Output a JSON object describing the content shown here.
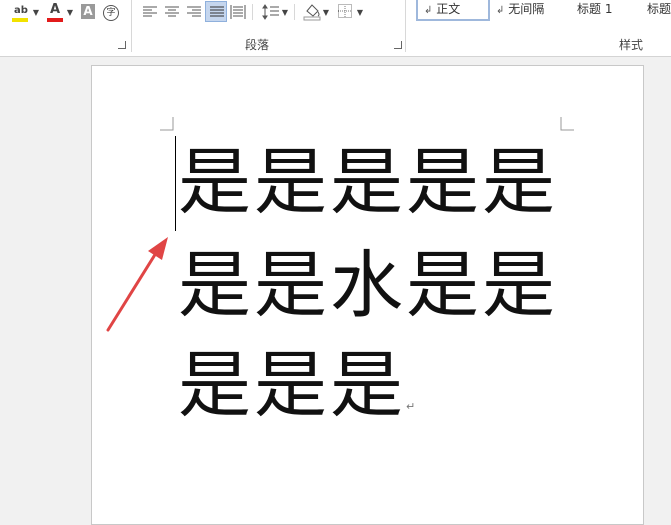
{
  "ribbon": {
    "font_group": {
      "highlight_icon": "highlight-color-icon",
      "highlight_color": "#f2e200",
      "font_color_icon": "font-color-icon",
      "font_color": "#e21b1b",
      "char_shading_label": "A",
      "enclosed_char_label": "字"
    },
    "paragraph_group": {
      "label": "段落"
    },
    "styles_group": {
      "label": "样式",
      "items": [
        {
          "label": "正文",
          "marker": "↲"
        },
        {
          "label": "无间隔",
          "marker": "↲"
        },
        {
          "label": "标题 1",
          "marker": ""
        },
        {
          "label": "标题",
          "marker": ""
        }
      ]
    }
  },
  "document": {
    "lines": [
      "是是是是是",
      "是是水是是",
      "是是是"
    ],
    "paragraph_mark": "↵",
    "annotation_color": "#e04545"
  }
}
